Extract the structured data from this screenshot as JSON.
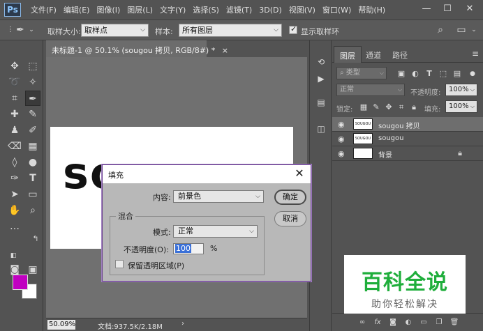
{
  "app": {
    "logo": "Ps",
    "menus": [
      "文件(F)",
      "编辑(E)",
      "图像(I)",
      "图层(L)",
      "文字(Y)",
      "选择(S)",
      "滤镜(T)",
      "3D(D)",
      "视图(V)",
      "窗口(W)",
      "帮助(H)"
    ]
  },
  "options_bar": {
    "sample_size_label": "取样大小:",
    "sample_size_value": "取样点",
    "sample_label": "样本:",
    "sample_value": "所有图层",
    "show_ring_label": "显示取样环",
    "show_ring_checked": true
  },
  "document": {
    "tab_title": "未标题-1 @ 50.1% (sougou 拷贝, RGB/8#) *",
    "close_glyph": "×",
    "canvas_text": "so",
    "zoom": "50.09%",
    "doc_info": "文档:937.5K/2.18M",
    "arrow": "›"
  },
  "colors": {
    "foreground": "#c000c0",
    "background": "#ffffff",
    "dialog_border": "#6a3f8f",
    "watermark_green": "#1fae3b"
  },
  "layers_panel": {
    "tabs": [
      "图层",
      "通道",
      "路径"
    ],
    "filter_kind": "类型",
    "blend_mode": "正常",
    "opacity_label": "不透明度:",
    "opacity_value": "100%",
    "lock_label": "锁定:",
    "fill_label": "填充:",
    "fill_value": "100%",
    "layers": [
      {
        "name": "sougou 拷贝",
        "thumb": "SOUGOU",
        "selected": true,
        "locked": false
      },
      {
        "name": "sougou",
        "thumb": "SOUGOU",
        "selected": false,
        "locked": false
      },
      {
        "name": "背景",
        "thumb": "",
        "selected": false,
        "locked": true
      }
    ],
    "bottom_fx": "fx"
  },
  "fill_dialog": {
    "title": "填充",
    "content_label": "内容:",
    "content_value": "前景色",
    "blend_group_label": "混合",
    "mode_label": "模式:",
    "mode_value": "正常",
    "opacity_label": "不透明度(O):",
    "opacity_value": "100",
    "opacity_unit": "%",
    "preserve_label": "保留透明区域(P)",
    "preserve_checked": false,
    "ok_label": "确定",
    "cancel_label": "取消"
  },
  "watermark": {
    "title": "百科全说",
    "subtitle": "助你轻松解决"
  }
}
